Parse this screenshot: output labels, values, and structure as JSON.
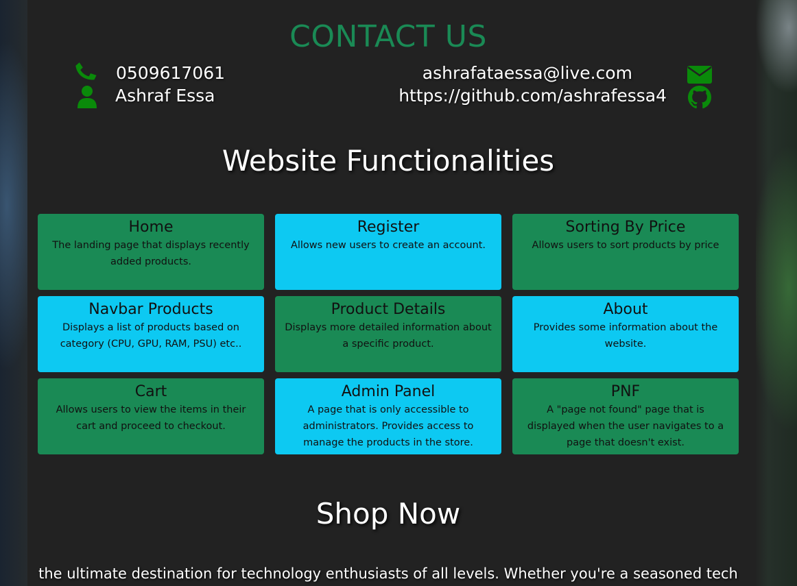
{
  "contact": {
    "title": "CONTACT US",
    "phone": "0509617061",
    "name": "Ashraf Essa",
    "email": "ashrafataessa@live.com",
    "github": "https://github.com/ashrafessa4",
    "icons": {
      "phone": "phone-icon",
      "user": "user-icon",
      "email": "envelope-icon",
      "github": "github-icon"
    },
    "accent_color": "#1a8a55",
    "icon_color": "#0a8a0a"
  },
  "functionalities": {
    "title": "Website Functionalities",
    "colors": {
      "green": "#1a8a55",
      "blue": "#0dc9f2"
    },
    "cards": [
      {
        "title": "Home",
        "description": "The landing page that displays recently added products."
      },
      {
        "title": "Register",
        "description": "Allows new users to create an account."
      },
      {
        "title": "Sorting By Price",
        "description": "Allows users to sort products by price"
      },
      {
        "title": "Navbar Products",
        "description": "Displays a list of products based on category (CPU, GPU, RAM, PSU) etc.."
      },
      {
        "title": "Product Details",
        "description": "Displays more detailed information about a specific product."
      },
      {
        "title": "About",
        "description": "Provides some information about the website."
      },
      {
        "title": "Cart",
        "description": "Allows users to view the items in their cart and proceed to checkout."
      },
      {
        "title": "Admin Panel",
        "description": "A page that is only accessible to administrators. Provides access to manage the products in the store."
      },
      {
        "title": "PNF",
        "description": "A \"page not found\" page that is displayed when the user navigates to a page that doesn't exist."
      }
    ]
  },
  "shop": {
    "title": "Shop Now",
    "text": "the ultimate destination for technology enthusiasts of all levels. Whether you're a seasoned tech"
  }
}
